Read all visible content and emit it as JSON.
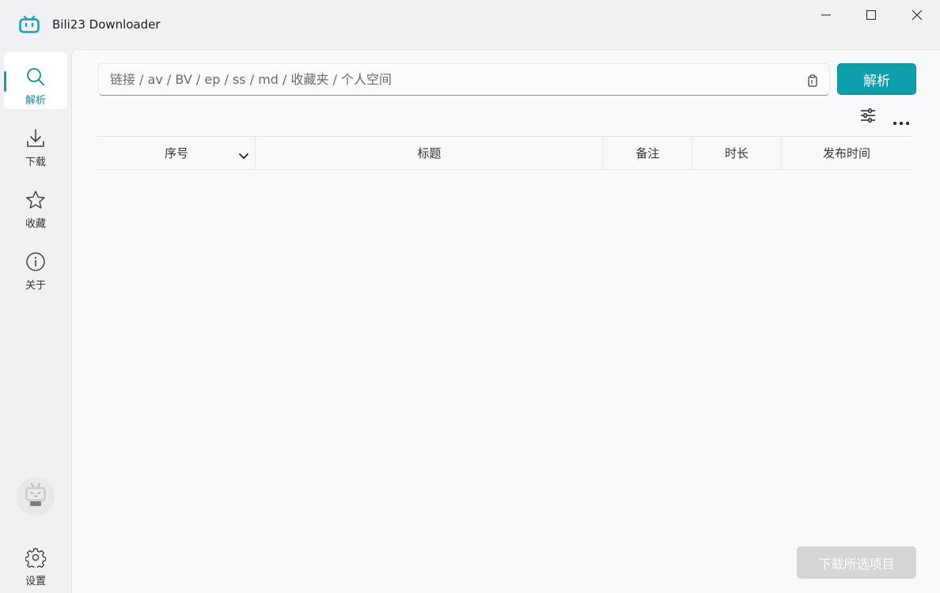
{
  "window": {
    "title": "Bili23 Downloader",
    "controls": [
      "minimize",
      "maximize",
      "close"
    ]
  },
  "sidebar": {
    "items": [
      {
        "label": "解析",
        "icon": "search-icon",
        "active": true
      },
      {
        "label": "下载",
        "icon": "download-icon",
        "active": false
      },
      {
        "label": "收藏",
        "icon": "star-icon",
        "active": false
      },
      {
        "label": "关于",
        "icon": "info-icon",
        "active": false
      }
    ],
    "settings": {
      "label": "设置",
      "icon": "gear-icon"
    },
    "avatar_icon": "bilibili-tv-avatar-icon"
  },
  "search": {
    "placeholder": "链接 / av / BV / ep / ss / md / 收藏夹 / 个人空间",
    "value": "",
    "parse_label": "解析"
  },
  "table": {
    "columns": [
      "序号",
      "标题",
      "备注",
      "时长",
      "发布时间"
    ],
    "rows": []
  },
  "footer": {
    "download_selected_label": "下载所选项目",
    "download_selected_enabled": false
  },
  "colors": {
    "accent": "#0e9fad",
    "disabled_button": "#d4d5d8"
  }
}
